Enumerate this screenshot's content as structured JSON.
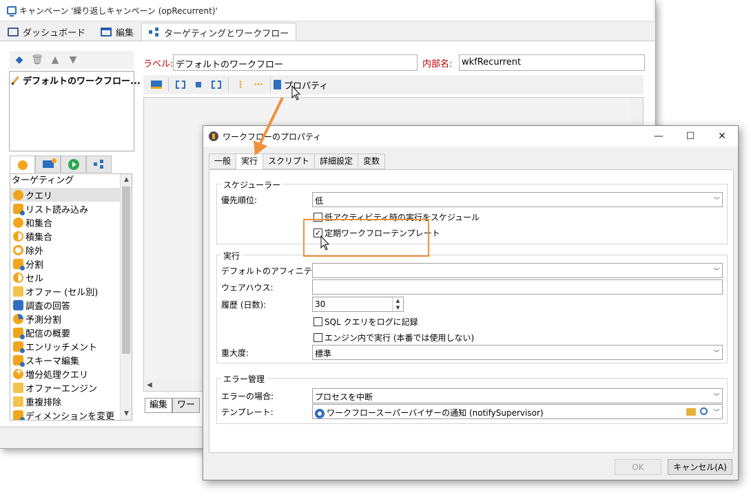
{
  "main_window": {
    "title": "キャンペーン '繰り返しキャンペーン (opRecurrent)'",
    "tabs": [
      {
        "label": "ダッシュボード"
      },
      {
        "label": "編集"
      },
      {
        "label": "ターゲティングとワークフロー"
      }
    ],
    "workflow_list": [
      "デフォルトのワークフロー..."
    ],
    "label_caption": "ラベル:",
    "label_value": "デフォルトのワークフロー",
    "internal_name_caption": "内部名:",
    "internal_name_value": "wkfRecurrent",
    "toolbar": {
      "properties_label": "プロパティ"
    },
    "activity_list": {
      "header": "ターゲティング",
      "items": [
        "クエリ",
        "リスト読み込み",
        "和集合",
        "積集合",
        "除外",
        "分割",
        "セル",
        "オファー (セル別)",
        "調査の回答",
        "予測分割",
        "配信の概要",
        "エンリッチメント",
        "スキーマ編集",
        "増分処理クエリ",
        "オファーエンジン",
        "重複排除",
        "ディメンションを変更"
      ]
    },
    "bottom_tabs": [
      "編集",
      "ワー"
    ]
  },
  "dialog": {
    "title": "ワークフローのプロパティ",
    "tabs": [
      "一般",
      "実行",
      "スクリプト",
      "詳細設定",
      "変数"
    ],
    "scheduler": {
      "group": "スケジューラー",
      "priority_label": "優先順位:",
      "priority_value": "低",
      "low_activity_checkbox": "低アクティビティ時の実行をスケジュール",
      "periodic_template_checkbox": "定期ワークフローテンプレート"
    },
    "execution": {
      "group": "実行",
      "affinity_label": "デフォルトのアフィニティ:",
      "affinity_value": "",
      "warehouse_label": "ウェアハウス:",
      "warehouse_value": "",
      "history_label": "履歴 (日数):",
      "history_value": "30",
      "sql_log_checkbox": "SQL クエリをログに記録",
      "engine_checkbox": "エンジン内で実行 (本番では使用しない)",
      "severity_label": "重大度:",
      "severity_value": "標準"
    },
    "error_management": {
      "group": "エラー管理",
      "on_error_label": "エラーの場合:",
      "on_error_value": "プロセスを中断",
      "template_label": "テンプレート:",
      "template_value": "ワークフロースーパーバイザーの通知 (notifySupervisor)"
    },
    "ok_label": "OK",
    "cancel_label": "キャンセル(A)"
  },
  "colors": {
    "accent_orange": "#f0913a",
    "brand_blue": "#2f6fbf"
  }
}
